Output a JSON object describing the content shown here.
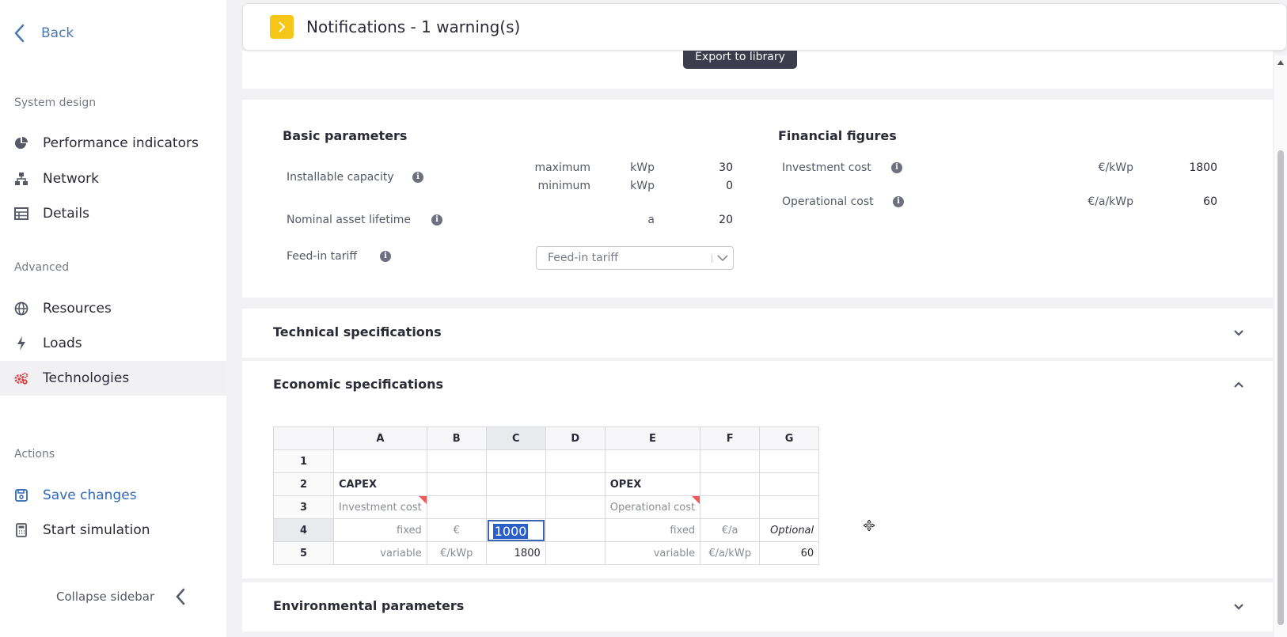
{
  "sidebar": {
    "back_label": "Back",
    "sections": {
      "system_design": "System design",
      "advanced": "Advanced",
      "actions": "Actions"
    },
    "system_design_items": [
      {
        "label": "Performance indicators",
        "icon": "pie-chart-icon"
      },
      {
        "label": "Network",
        "icon": "network-icon"
      },
      {
        "label": "Details",
        "icon": "table-icon"
      }
    ],
    "advanced_items": [
      {
        "label": "Resources",
        "icon": "globe-icon"
      },
      {
        "label": "Loads",
        "icon": "bolt-icon"
      },
      {
        "label": "Technologies",
        "icon": "gears-icon",
        "active": true
      }
    ],
    "action_items": [
      {
        "label": "Save changes",
        "icon": "save-icon"
      },
      {
        "label": "Start simulation",
        "icon": "calculator-icon"
      }
    ],
    "collapse_label": "Collapse sidebar"
  },
  "notifications": {
    "title": "Notifications - 1 warning(s)",
    "accent": "#f5c518"
  },
  "export_button": "Export to library",
  "basic_parameters": {
    "title": "Basic parameters",
    "installable_capacity": {
      "label": "Installable capacity",
      "maximum_label": "maximum",
      "minimum_label": "minimum",
      "unit": "kWp",
      "maximum": "30",
      "minimum": "0"
    },
    "lifetime": {
      "label": "Nominal asset lifetime",
      "unit": "a",
      "value": "20"
    },
    "feed_in": {
      "label": "Feed-in tariff",
      "placeholder": "Feed-in tariff"
    }
  },
  "financial_figures": {
    "title": "Financial figures",
    "investment": {
      "label": "Investment cost",
      "unit": "€/kWp",
      "value": "1800"
    },
    "operational": {
      "label": "Operational cost",
      "unit": "€/a/kWp",
      "value": "60"
    }
  },
  "accordions": {
    "technical": "Technical specifications",
    "economic": "Economic specifications",
    "environmental": "Environmental parameters"
  },
  "sheet": {
    "columns": [
      "A",
      "B",
      "C",
      "D",
      "E",
      "F",
      "G"
    ],
    "rows": [
      "1",
      "2",
      "3",
      "4",
      "5"
    ],
    "cells": {
      "A2": "CAPEX",
      "E2": "OPEX",
      "A3": "Investment cost",
      "E3": "Operational cost",
      "A4": "fixed",
      "B4": "€",
      "C4": "1000",
      "E4": "fixed",
      "F4": "€/a",
      "G4": "Optional",
      "A5": "variable",
      "B5": "€/kWp",
      "C5": "1800",
      "E5": "variable",
      "F5": "€/a/kWp",
      "G5": "60"
    }
  }
}
